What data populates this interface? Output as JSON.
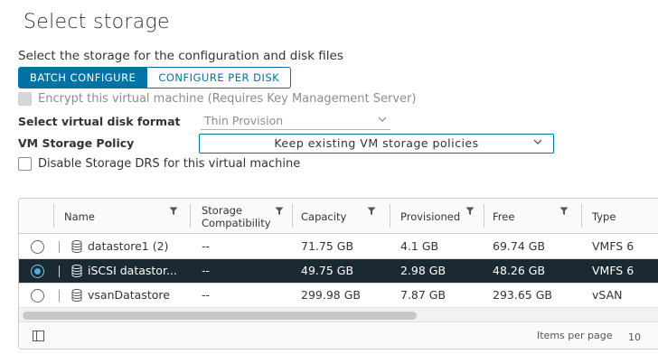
{
  "page": {
    "title": "Select storage",
    "subtitle": "Select the storage for the configuration and disk files"
  },
  "tabs": {
    "batch": "BATCH CONFIGURE",
    "per_disk": "CONFIGURE PER DISK"
  },
  "encrypt": {
    "label": "Encrypt this virtual machine (Requires Key Management Server)",
    "checked": false,
    "disabled": true
  },
  "disk_format": {
    "label": "Select virtual disk format",
    "value": "Thin Provision"
  },
  "storage_policy": {
    "label": "VM Storage Policy",
    "value": "Keep existing VM storage policies"
  },
  "drs": {
    "label": "Disable Storage DRS for this virtual machine",
    "checked": false
  },
  "table": {
    "columns": {
      "name": "Name",
      "compat_line1": "Storage",
      "compat_line2": "Compatibility",
      "capacity": "Capacity",
      "provisioned": "Provisioned",
      "free": "Free",
      "type": "Type"
    },
    "rows": [
      {
        "name": "datastore1 (2)",
        "compat": "--",
        "capacity": "71.75 GB",
        "provisioned": "4.1 GB",
        "free": "69.74 GB",
        "type": "VMFS 6",
        "selected": false
      },
      {
        "name": "iSCSI datastor...",
        "compat": "--",
        "capacity": "49.75 GB",
        "provisioned": "2.98 GB",
        "free": "48.26 GB",
        "type": "VMFS 6",
        "selected": true
      },
      {
        "name": "vsanDatastore",
        "compat": "--",
        "capacity": "299.98 GB",
        "provisioned": "7.87 GB",
        "free": "293.65 GB",
        "type": "vSAN",
        "selected": false
      }
    ],
    "footer": {
      "items_per_page_label": "Items per page",
      "items_per_page_value": "10"
    }
  },
  "icons": {
    "datastore": "database-icon",
    "filter": "filter-icon",
    "dropdown": "chevron-down-icon",
    "column_toggle": "column-toggle-icon"
  },
  "colors": {
    "accent": "#0072a3",
    "selected_row": "#1b2a32",
    "radio_selected": "#49afd9"
  }
}
